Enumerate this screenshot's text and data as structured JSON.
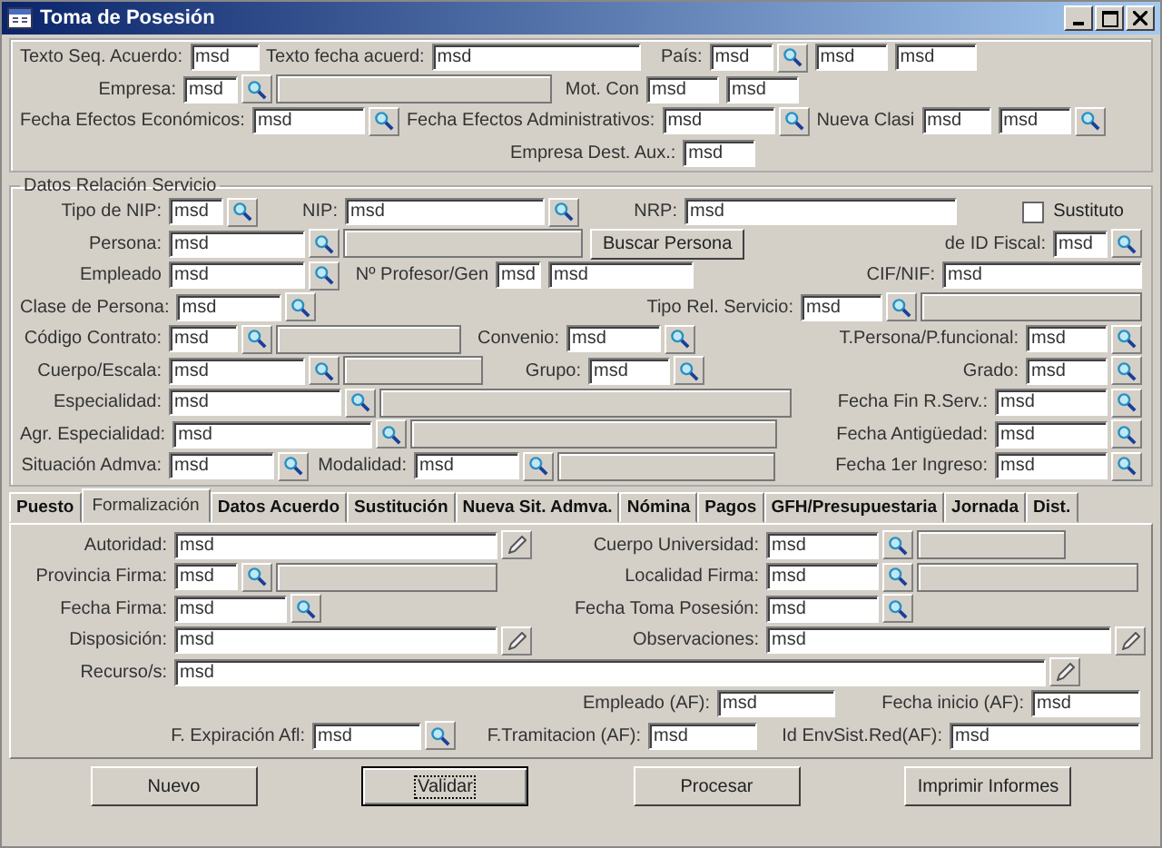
{
  "window": {
    "title": "Toma de Posesión"
  },
  "top": {
    "lines": [
      {
        "fields": [
          {
            "kind": "field",
            "label": "Texto Seq. Acuerdo:",
            "value": "msd"
          },
          {
            "kind": "field",
            "label": "Texto fecha acuerd:",
            "value": "msd"
          },
          {
            "kind": "field",
            "label": "País:",
            "value": "msd",
            "search_button": true
          },
          {
            "kind": "field",
            "value": "msd"
          },
          {
            "kind": "field",
            "value": "msd"
          }
        ]
      },
      {
        "fields": [
          {
            "kind": "field",
            "label": "Empresa:",
            "value": "msd",
            "search_button": true,
            "info_box": true
          },
          {
            "kind": "field",
            "label": "Mot. Con",
            "value": "msd"
          },
          {
            "kind": "field",
            "value": "msd"
          }
        ]
      },
      {
        "fields": [
          {
            "kind": "field",
            "label": "Fecha Efectos Económicos:",
            "value": "msd",
            "search_button": true
          },
          {
            "kind": "field",
            "label": "Fecha Efectos Administrativos:",
            "value": "msd",
            "search_button": true
          },
          {
            "kind": "field",
            "label": "Nueva Clasi",
            "value": "msd"
          },
          {
            "kind": "field",
            "value": "msd",
            "search_button": true
          }
        ]
      },
      {
        "fields": [
          {
            "kind": "field",
            "label": "Empresa Dest. Aux.:",
            "value": "msd"
          }
        ]
      }
    ]
  },
  "service": {
    "title": "Datos Relación Servicio",
    "lines": [
      {
        "fields": [
          {
            "kind": "field",
            "label": "Tipo de NIP:",
            "value": "msd",
            "search_button": true
          },
          {
            "kind": "field",
            "label": "NIP:",
            "value": "msd",
            "search_button": true
          },
          {
            "kind": "field",
            "label": "NRP:",
            "value": "msd"
          },
          {
            "kind": "checkbox",
            "label": "Sustituto",
            "checked": false
          }
        ]
      },
      {
        "fields": [
          {
            "kind": "field",
            "label": "Persona:",
            "value": "msd",
            "search_button": true,
            "info_box": true
          },
          {
            "kind": "button",
            "label": "Buscar Persona"
          },
          {
            "kind": "field",
            "label": "de ID Fiscal:",
            "value": "msd",
            "search_button": true
          }
        ]
      },
      {
        "fields": [
          {
            "kind": "field",
            "label": "Empleado",
            "value": "msd",
            "search_button": true
          },
          {
            "kind": "field",
            "label": "Nº Profesor/Gen",
            "value": "msd"
          },
          {
            "kind": "field",
            "value": "msd"
          },
          {
            "kind": "field",
            "label": "CIF/NIF:",
            "value": "msd"
          }
        ]
      },
      {
        "fields": [
          {
            "kind": "field",
            "label": "Clase de Persona:",
            "value": "msd",
            "search_button": true
          },
          {
            "kind": "field",
            "label": "Tipo Rel. Servicio:",
            "value": "msd",
            "search_button": true,
            "info_box": true
          }
        ]
      },
      {
        "fields": [
          {
            "kind": "field",
            "label": "Código Contrato:",
            "value": "msd",
            "search_button": true,
            "info_box": true
          },
          {
            "kind": "field",
            "label": "Convenio:",
            "value": "msd",
            "search_button": true
          },
          {
            "kind": "field",
            "label": "T.Persona/P.funcional:",
            "value": "msd",
            "search_button": true
          }
        ]
      },
      {
        "fields": [
          {
            "kind": "field",
            "label": "Cuerpo/Escala:",
            "value": "msd",
            "search_button": true,
            "info_box": true
          },
          {
            "kind": "field",
            "label": "Grupo:",
            "value": "msd",
            "search_button": true
          },
          {
            "kind": "field",
            "label": "Grado:",
            "value": "msd",
            "search_button": true
          }
        ]
      },
      {
        "fields": [
          {
            "kind": "field",
            "label": "Especialidad:",
            "value": "msd",
            "search_button": true,
            "info_box": true
          },
          {
            "kind": "field",
            "label": "Fecha Fin R.Serv.:",
            "value": "msd",
            "search_button": true
          }
        ]
      },
      {
        "fields": [
          {
            "kind": "field",
            "label": "Agr. Especialidad:",
            "value": "msd",
            "search_button": true,
            "info_box": true
          },
          {
            "kind": "field",
            "label": "Fecha Antigüedad:",
            "value": "msd",
            "search_button": true
          }
        ]
      },
      {
        "fields": [
          {
            "kind": "field",
            "label": "Situación Admva:",
            "value": "msd",
            "search_button": true
          },
          {
            "kind": "field",
            "label": "Modalidad:",
            "value": "msd",
            "search_button": true,
            "info_box": true
          },
          {
            "kind": "field",
            "label": "Fecha 1er Ingreso:",
            "value": "msd",
            "search_button": true
          }
        ]
      }
    ]
  },
  "tabs": [
    {
      "label": "Puesto",
      "selected": false
    },
    {
      "label": "Formalización",
      "selected": true
    },
    {
      "label": "Datos Acuerdo",
      "selected": false
    },
    {
      "label": "Sustitución",
      "selected": false
    },
    {
      "label": "Nueva Sit. Admva.",
      "selected": false
    },
    {
      "label": "Nómina",
      "selected": false
    },
    {
      "label": "Pagos",
      "selected": false
    },
    {
      "label": "GFH/Presupuestaria",
      "selected": false
    },
    {
      "label": "Jornada",
      "selected": false
    },
    {
      "label": "Dist.",
      "selected": false
    }
  ],
  "tab_panel": {
    "lines": [
      {
        "fields": [
          {
            "kind": "field",
            "label": "Autoridad:",
            "value": "msd",
            "edit_button": true
          },
          {
            "kind": "field",
            "label": "Cuerpo Universidad:",
            "value": "msd",
            "search_button": true,
            "info_box": true
          }
        ]
      },
      {
        "fields": [
          {
            "kind": "field",
            "label": "Provincia Firma:",
            "value": "msd",
            "search_button": true,
            "info_box": true
          },
          {
            "kind": "field",
            "label": "Localidad Firma:",
            "value": "msd",
            "search_button": true,
            "info_box": true
          }
        ]
      },
      {
        "fields": [
          {
            "kind": "field",
            "label": "Fecha Firma:",
            "value": "msd",
            "search_button": true
          },
          {
            "kind": "field",
            "label": "Fecha Toma Posesión:",
            "value": "msd",
            "search_button": true
          }
        ]
      },
      {
        "fields": [
          {
            "kind": "field",
            "label": "Disposición:",
            "value": "msd",
            "edit_button": true
          },
          {
            "kind": "field",
            "label": "Observaciones:",
            "value": "msd",
            "edit_button": true
          }
        ]
      },
      {
        "fields": [
          {
            "kind": "field",
            "label": "Recurso/s:",
            "value": "msd",
            "edit_button": true
          }
        ]
      }
    ]
  },
  "af": {
    "lines": [
      {
        "fields": [
          {
            "kind": "field",
            "label": "Empleado (AF):",
            "value": "msd"
          },
          {
            "kind": "field",
            "label": "Fecha inicio (AF):",
            "value": "msd"
          }
        ]
      },
      {
        "fields": [
          {
            "kind": "field",
            "label": "F. Expiración Afl:",
            "value": "msd",
            "search_button": true
          },
          {
            "kind": "field",
            "label": "F.Tramitacion (AF):",
            "value": "msd"
          },
          {
            "kind": "field",
            "label": "Id EnvSist.Red(AF):",
            "value": "msd"
          }
        ]
      }
    ]
  },
  "buttons": [
    {
      "label": "Nuevo",
      "default": false
    },
    {
      "label": "Validar",
      "default": true
    },
    {
      "label": "Procesar",
      "default": false
    },
    {
      "label": "Imprimir Informes",
      "default": false
    }
  ]
}
